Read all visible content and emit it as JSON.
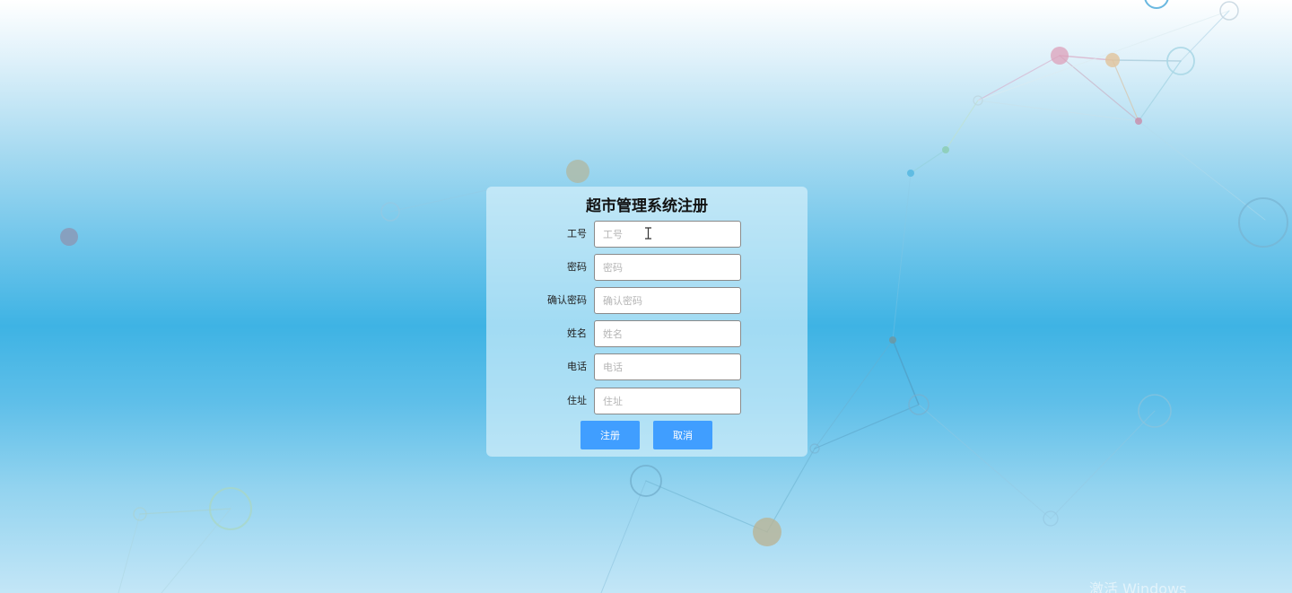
{
  "form": {
    "title": "超市管理系统注册",
    "fields": [
      {
        "label": "工号",
        "placeholder": "工号",
        "value": ""
      },
      {
        "label": "密码",
        "placeholder": "密码",
        "value": ""
      },
      {
        "label": "确认密码",
        "placeholder": "确认密码",
        "value": ""
      },
      {
        "label": "姓名",
        "placeholder": "姓名",
        "value": ""
      },
      {
        "label": "电话",
        "placeholder": "电话",
        "value": ""
      },
      {
        "label": "住址",
        "placeholder": "住址",
        "value": ""
      }
    ],
    "register_label": "注册",
    "cancel_label": "取消"
  },
  "watermark": {
    "text": "激活 Windows"
  },
  "colors": {
    "button": "#409eff",
    "background_mid": "#3eb3e4"
  }
}
